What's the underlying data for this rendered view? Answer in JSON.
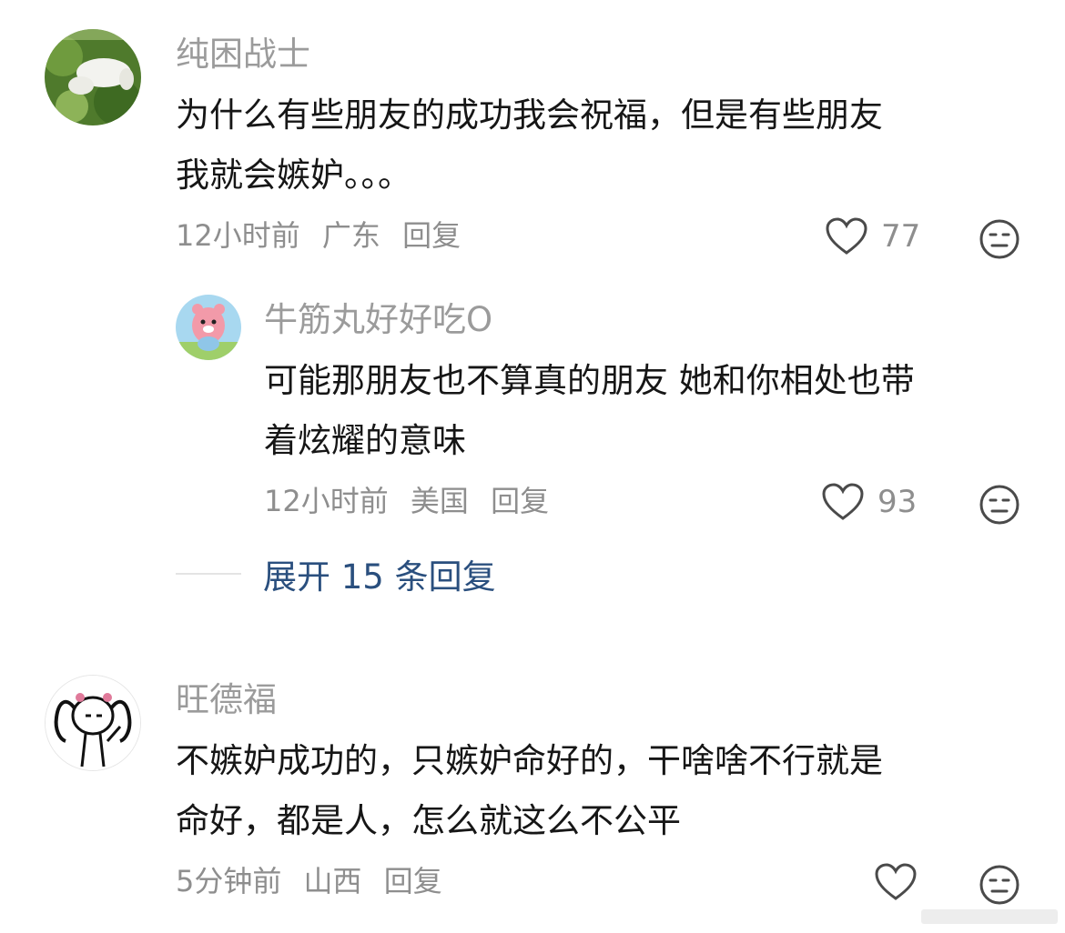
{
  "comments": [
    {
      "username": "纯困战士",
      "text_line1": "为什么有些朋友的成功我会祝福，但是有些朋友",
      "text_line2": "我就会嫉妒。。。",
      "time": "12小时前",
      "location": "广东",
      "reply": "回复",
      "likes": "77",
      "avatar_icon": "cat-photo-avatar"
    },
    {
      "username": "旺德福",
      "text_line1": "不嫉妒成功的，只嫉妒命好的，干啥啥不行就是",
      "text_line2": "命好，都是人，怎么就这么不公平",
      "time": "5分钟前",
      "location": "山西",
      "reply": "回复",
      "avatar_icon": "stick-figure-avatar"
    }
  ],
  "sub_reply": {
    "username": "牛筋丸好好吃O",
    "text_line1": "可能那朋友也不算真的朋友 她和你相处也带",
    "text_line2": "着炫耀的意味",
    "time": "12小时前",
    "location": "美国",
    "reply": "回复",
    "likes": "93",
    "avatar_icon": "pink-beaver-avatar"
  },
  "expand": {
    "label": "展开 15 条回复"
  },
  "colors": {
    "link": "#2a4f7e",
    "meta": "#8e8e8e",
    "username": "#9b9b9b"
  }
}
